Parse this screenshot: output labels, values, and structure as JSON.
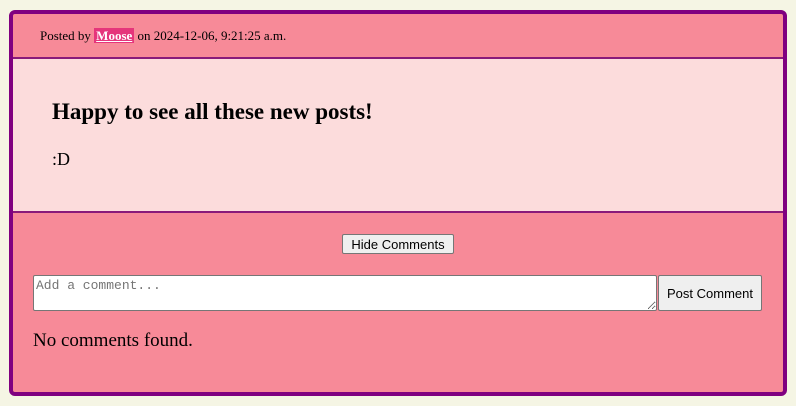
{
  "post": {
    "posted_prefix": "Posted by ",
    "author": "Moose",
    "posted_suffix": " on 2024-12-06, 9:21:25 a.m.",
    "title": "Happy to see all these new posts!",
    "content": ":D"
  },
  "comments": {
    "hide_label": "Hide Comments",
    "input_placeholder": "Add a comment...",
    "input_value": "",
    "post_label": "Post Comment",
    "empty_text": "No comments found."
  },
  "colors": {
    "page_background": "#f5f5e4",
    "post_border": "#800080",
    "post_background": "#f78a98",
    "body_background": "#fcdcdc",
    "author_highlight": "#e5357b"
  }
}
